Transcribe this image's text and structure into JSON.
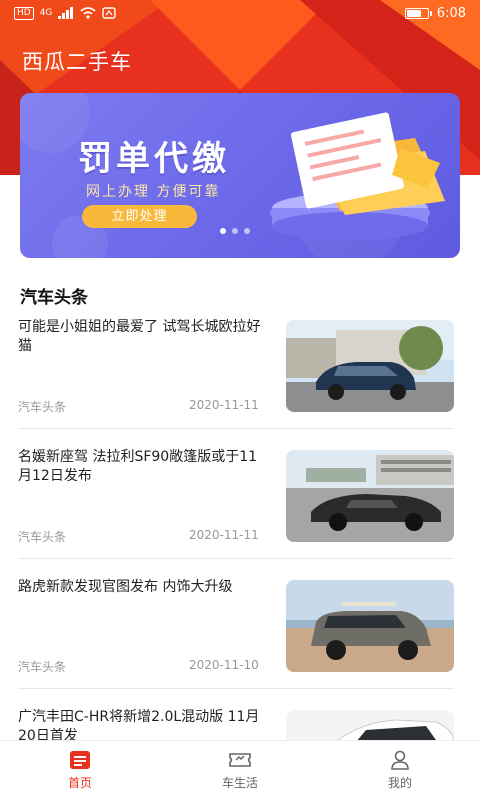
{
  "status_bar": {
    "left_icons": [
      "hd-icon",
      "signal-icon",
      "wifi-icon",
      "nfc-icon"
    ],
    "hd_label": "HD",
    "network_label": "4G",
    "time": "6:08",
    "battery_level": 0.75
  },
  "app": {
    "title": "西瓜二手车",
    "accent_color": "#e8301f"
  },
  "banner": {
    "title": "罚单代缴",
    "subtitle": "网上办理 方便可靠",
    "button_label": "立即处理",
    "page_count": 3,
    "active_page": 0
  },
  "section": {
    "title": "汽车头条"
  },
  "news": [
    {
      "title": "可能是小姐姐的最爱了 试驾长城欧拉好猫",
      "source": "汽车头条",
      "date": "2020-11-11",
      "thumb": "dark-blue-hatchback-photo"
    },
    {
      "title": "名媛新座驾 法拉利SF90敞篷版或于11月12日发布",
      "source": "汽车头条",
      "date": "2020-11-11",
      "thumb": "camouflaged-sports-car-photo"
    },
    {
      "title": "路虎新款发现官图发布 内饰大升级",
      "source": "汽车头条",
      "date": "2020-11-10",
      "thumb": "grey-suv-beach-photo"
    },
    {
      "title": "广汽丰田C-HR将新增2.0L混动版 11月20日首发",
      "source": "",
      "date": "",
      "thumb": "white-suv-photo"
    }
  ],
  "bottom_nav": [
    {
      "label": "首页",
      "icon": "home-list-icon",
      "active": true
    },
    {
      "label": "车生活",
      "icon": "car-ticket-icon",
      "active": false
    },
    {
      "label": "我的",
      "icon": "user-icon",
      "active": false
    }
  ]
}
